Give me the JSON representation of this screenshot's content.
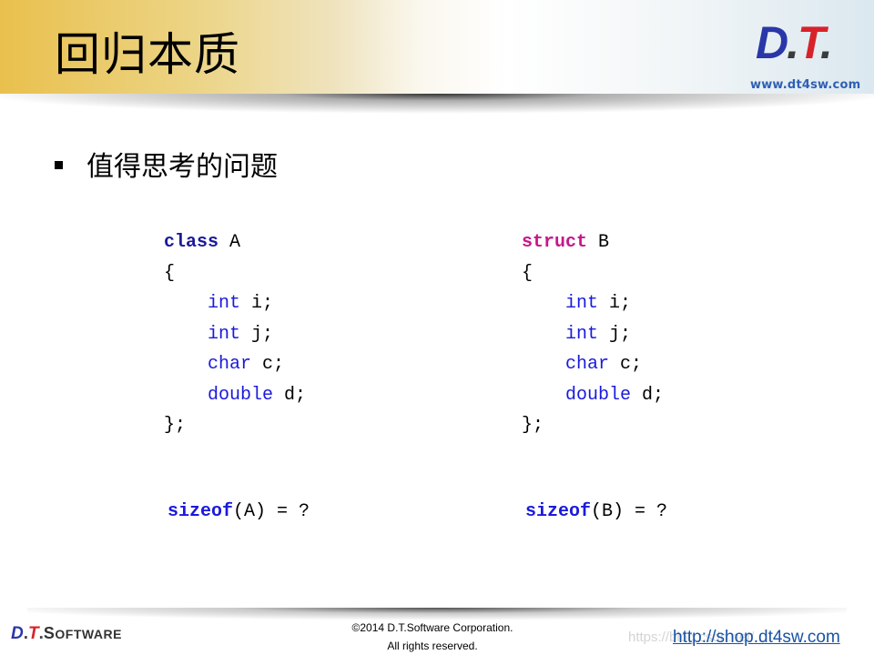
{
  "header": {
    "title": "回归本质",
    "logo": {
      "d": "D",
      "t": "T",
      "dot": ".",
      "url": "www.dt4sw.com"
    },
    "colors": {
      "logo_d": "#2a37a8",
      "logo_t": "#d8222a",
      "url": "#2f5fb3",
      "gradient_left": "#e9c04d"
    }
  },
  "bullet": {
    "text": "值得思考的问题"
  },
  "code_a": {
    "keyword": "class",
    "name": "A",
    "open": "{",
    "members": [
      {
        "type": "int",
        "rest": " i;"
      },
      {
        "type": "int",
        "rest": " j;"
      },
      {
        "type": "char",
        "rest": " c;"
      },
      {
        "type": "double",
        "rest": " d;"
      }
    ],
    "close": "};",
    "sizeof_kw": "sizeof",
    "sizeof_rest": "(A) = ?"
  },
  "code_b": {
    "keyword": "struct",
    "name": "B",
    "open": "{",
    "members": [
      {
        "type": "int",
        "rest": " i;"
      },
      {
        "type": "int",
        "rest": " j;"
      },
      {
        "type": "char",
        "rest": " c;"
      },
      {
        "type": "double",
        "rest": " d;"
      }
    ],
    "close": "};",
    "sizeof_kw": "sizeof",
    "sizeof_rest": "(B) = ?"
  },
  "code_colors": {
    "type": "#1a1adc",
    "class_kw": "#1a1a9a",
    "struct_kw": "#c5168c"
  },
  "footer": {
    "logo_d": "D",
    "logo_dot": ".",
    "logo_t": "T",
    "logo_dot2": ".",
    "logo_s": "S",
    "logo_rest": "OFTWARE",
    "copyright_line1": "©2014 D.T.Software Corporation.",
    "copyright_line2": "All rights reserved.",
    "watermark": "https://blog.csdn.net/...",
    "shop_link": "http://shop.dt4sw.com"
  }
}
